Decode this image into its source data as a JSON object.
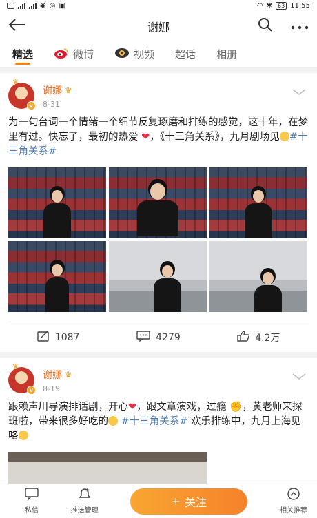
{
  "status_bar": {
    "time": "11:55",
    "battery": "63"
  },
  "header": {
    "title": "谢娜"
  },
  "tabs": [
    {
      "label": "精选",
      "active": true
    },
    {
      "label": "微博",
      "icon": "weibo-icon"
    },
    {
      "label": "视频",
      "icon": "video-camera-icon"
    },
    {
      "label": "超话"
    },
    {
      "label": "相册"
    }
  ],
  "posts": [
    {
      "author": "谢娜",
      "date": "8-31",
      "text_1": "为一句台词一个情绪一个细节反复琢磨和排练的感觉，这十年，在梦里有过。快忘了，最初的热爱",
      "text_2": "，《十三角关系》，九月剧场见",
      "hashtag": "#十三角关系#",
      "repost_count": "1087",
      "comment_count": "4279",
      "like_count": "4.2万"
    },
    {
      "author": "谢娜",
      "date": "8-19",
      "text_1": "跟赖声川导演排话剧，开心",
      "text_2": "，跟文章演戏，过瘾",
      "text_3": "，黄老师来探班啦，带来很多好吃的",
      "hashtag": "#十三角关系#",
      "text_4": "欢乐排练中，九月上海见咯"
    }
  ],
  "bottom_bar": {
    "message_label": "私信",
    "manage_label": "推送管理",
    "follow_label": "关注",
    "recommend_label": "相关推荐"
  },
  "colors": {
    "accent": "#ff8200",
    "link": "#507daf",
    "username": "#e86b1d"
  }
}
